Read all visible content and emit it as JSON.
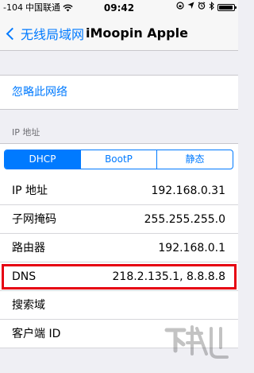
{
  "status_bar": {
    "signal": "-104",
    "carrier": "中国联通",
    "time": "09:42"
  },
  "nav": {
    "back_label": "无线局域网",
    "title": "iMoopin Apple"
  },
  "forget_network": {
    "label": "忽略此网络"
  },
  "ip_section": {
    "header": "IP 地址",
    "segments": [
      "DHCP",
      "BootP",
      "静态"
    ],
    "selected_segment": "DHCP"
  },
  "rows": [
    {
      "label": "IP 地址",
      "value": "192.168.0.31"
    },
    {
      "label": "子网掩码",
      "value": "255.255.255.0"
    },
    {
      "label": "路由器",
      "value": "192.168.0.1"
    },
    {
      "label": "DNS",
      "value": "218.2.135.1, 8.8.8.8"
    },
    {
      "label": "搜索域",
      "value": ""
    },
    {
      "label": "客户端 ID",
      "value": ""
    }
  ],
  "colors": {
    "accent": "#007aff",
    "highlight_border": "#e60012",
    "background": "#efeff4"
  }
}
